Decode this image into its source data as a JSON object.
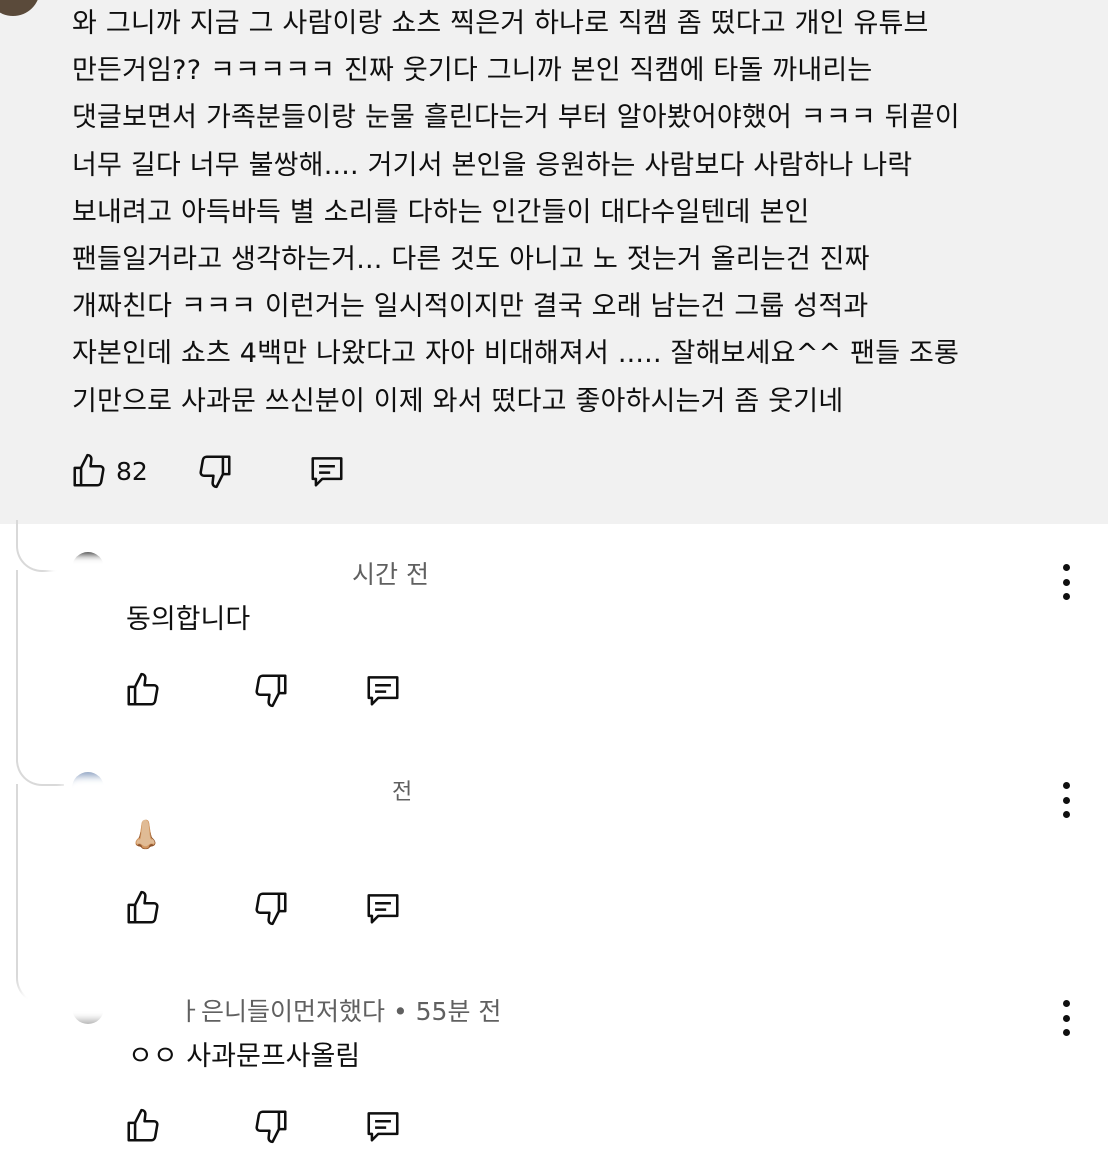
{
  "main_comment": {
    "text": "와 그니까 지금 그 사람이랑 쇼츠 찍은거 하나로 직캠 좀 떴다고 개인 유튜브\n만든거임?? ㅋㅋㅋㅋㅋ 진짜 웃기다 그니까 본인 직캠에 타돌 까내리는\n댓글보면서 가족분들이랑 눈물 흘린다는거 부터 알아봤어야했어 ㅋㅋㅋ 뒤끝이\n너무 길다 너무 불쌍해.... 거기서 본인을 응원하는 사람보다 사람하나 나락\n보내려고 아득바득 별 소리를 다하는 인간들이 대다수일텐데 본인\n팬들일거라고 생각하는거... 다른 것도 아니고 노 젓는거 올리는건 진짜\n개짜친다 ㅋㅋㅋ 이런거는 일시적이지만 결국 오래 남는건 그룹 성적과\n자본인데 쇼츠 4백만 나왔다고 자아 비대해져서 ..... 잘해보세요^^ 팬들 조롱\n기만으로 사과문 쓰신분이 이제 와서 떴다고 좋아하시는거 좀 웃기네",
    "like_count": "82"
  },
  "replies": [
    {
      "meta_visible": "시간 전",
      "text": "동의합니다",
      "avatar_color": "#1a1a1a"
    },
    {
      "meta_visible": "전",
      "text": "👃🏼",
      "avatar_color": "#8a9fc0"
    },
    {
      "meta_visible": "ㅏ은니들이먼저했다 • 55분 전",
      "text": "ㅇㅇ 사과문프사올림",
      "avatar_color": "#b0b0b0"
    }
  ],
  "icons": {
    "like": "thumbs-up-icon",
    "dislike": "thumbs-down-icon",
    "reply": "comment-icon",
    "more": "more-vert-icon"
  },
  "colors": {
    "top_background": "#f1f1f1",
    "text": "#0f0f0f",
    "meta": "#606060",
    "thread_line": "#d9d9d9"
  }
}
